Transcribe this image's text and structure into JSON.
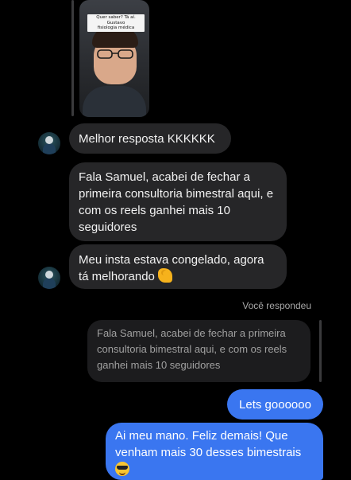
{
  "reel": {
    "caption_line1": "Quer saber? Tá aí. Gustavo",
    "caption_line2": "fisiologia médica"
  },
  "messages": [
    {
      "id": "m1",
      "direction": "incoming",
      "text": "Melhor resposta KKKKKK"
    },
    {
      "id": "m2",
      "direction": "incoming",
      "text": "Fala Samuel, acabei de fechar a primeira consultoria bimestral aqui, e com os reels ganhei mais 10 seguidores"
    },
    {
      "id": "m3",
      "direction": "incoming",
      "text": "Meu insta estava congelado, agora tá melhorando",
      "emoji": "flexed-biceps"
    }
  ],
  "reply": {
    "label": "Você respondeu",
    "quoted_text": "Fala Samuel, acabei de fechar a primeira consultoria bimestral aqui, e com os reels ganhei mais 10 seguidores"
  },
  "outgoing": [
    {
      "id": "o1",
      "text": "Lets goooooo"
    },
    {
      "id": "o2",
      "text": "Ai meu mano. Feliz demais! Que venham mais 30 desses bimestrais",
      "emoji": "smiling-face-with-sunglasses"
    }
  ],
  "colors": {
    "background": "#000000",
    "incoming_bubble": "#262628",
    "outgoing_bubble": "#3a76f0",
    "quoted_bubble": "#1c1c1e"
  }
}
